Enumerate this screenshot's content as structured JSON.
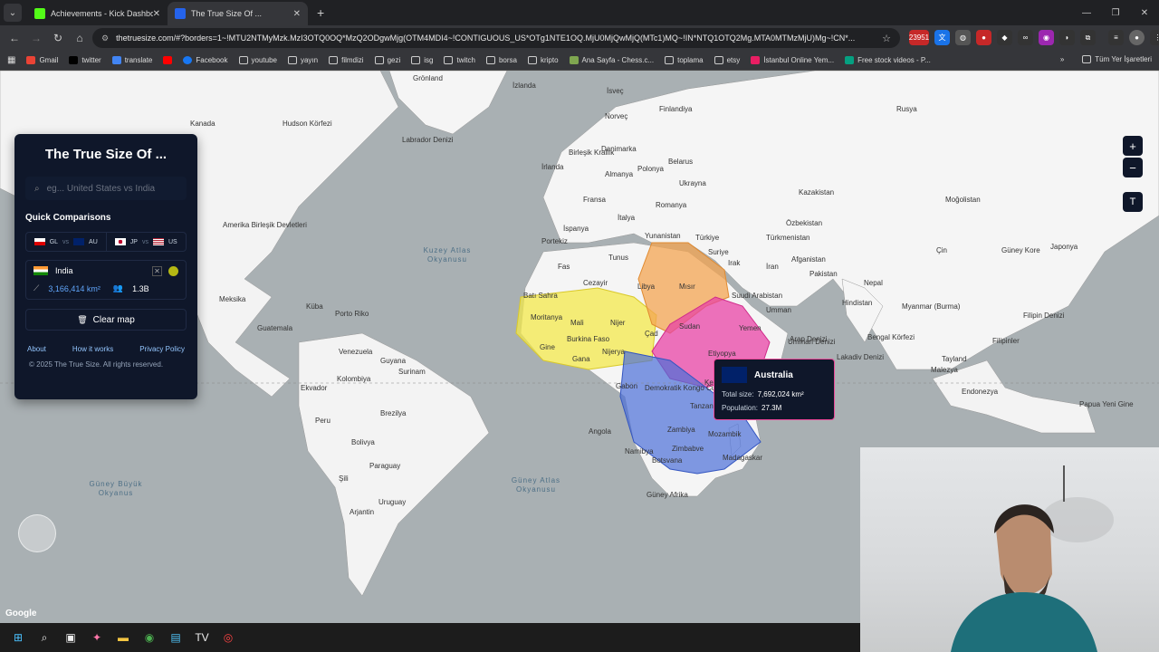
{
  "browser": {
    "tabs": [
      {
        "title": "Achievements - Kick Dashboard",
        "color": "#53fc18"
      },
      {
        "title": "The True Size Of ...",
        "color": "#2563eb"
      }
    ],
    "url": "thetruesize.com/#?borders=1~!MTU2NTMyMzk.MzI3OTQ0OQ*MzQ2ODgwMjg(OTM4MDI4~!CONTIGUOUS_US*OTg1NTE1OQ.MjU0MjQwMjQ(MTc1)MQ~!IN*NTQ1OTQ2Mg.MTA0MTMzMjU)Mg~!CN*...",
    "ext_badge": "23951",
    "bookmarks": [
      "Gmail",
      "twitter",
      "translate",
      "Facebook",
      "youtube",
      "yayın",
      "filmdizi",
      "gezi",
      "isg",
      "twitch",
      "borsa",
      "kripto",
      "Ana Sayfa - Chess.c...",
      "toplama",
      "etsy",
      "İstanbul Online Yem...",
      "Free stock videos - P..."
    ],
    "bookmarks_right": "Tüm Yer İşaretleri"
  },
  "panel": {
    "title": "The True Size Of ...",
    "search_placeholder": "eg... United States vs India",
    "quick_title": "Quick Comparisons",
    "quick": [
      {
        "a": "GL",
        "vs": "vs",
        "b": "AU"
      },
      {
        "a": "JP",
        "vs": "vs",
        "b": "US"
      }
    ],
    "country": {
      "name": "India",
      "area": "3,166,414 km²",
      "population": "1.3B",
      "color": "#b5b814"
    },
    "clear_label": "Clear map",
    "links": [
      "About",
      "How it works",
      "Privacy Policy"
    ],
    "copyright": "© 2025 The True Size. All rights reserved."
  },
  "tooltip": {
    "name": "Australia",
    "size_label": "Total size:",
    "size_value": "7,692,024 km²",
    "pop_label": "Population:",
    "pop_value": "27.3M"
  },
  "map": {
    "google": "Google",
    "labels": [
      "Grönland",
      "İzlanda",
      "İsveç",
      "Norveç",
      "Finlandiya",
      "Rusya",
      "Kanada",
      "Hudson Körfezi",
      "Labrador Denizi",
      "Birleşik Krallık",
      "Danimarka",
      "Belarus",
      "Polonya",
      "İrlanda",
      "Almanya",
      "Fransa",
      "Ukrayna",
      "Kazakistan",
      "Moğolistan",
      "Amerika Birleşik Devletleri",
      "İtalya",
      "Romanya",
      "İspanya",
      "Yunanistan",
      "Türkiye",
      "Özbekistan",
      "Türkmenistan",
      "Çin",
      "Güney Kore",
      "Japonya",
      "Portekiz",
      "Tunus",
      "Suriye",
      "Irak",
      "İran",
      "Afganistan",
      "Pakistan",
      "Fas",
      "Cezayir",
      "Libya",
      "Mısır",
      "Suudi Arabistan",
      "Meksika",
      "Küba",
      "Nepal",
      "Hindistan",
      "Umman",
      "Myanmar (Burma)",
      "Batı Sahra",
      "Moritanya",
      "Mali",
      "Nijer",
      "Çad",
      "Sudan",
      "Yemen",
      "Guatemala",
      "Porto Riko",
      "Burkina Faso",
      "Nijerya",
      "Gine",
      "Gana",
      "Etiyopya",
      "Venezuela",
      "Guyana",
      "Surinam",
      "Kolombiya",
      "Ekvador",
      "Gabon",
      "Demokratik Kongo Cumhuriyeti",
      "Tanzanya",
      "Kenya",
      "Peru",
      "Brezilya",
      "Bolivya",
      "Zambiya",
      "Mozambik",
      "Angola",
      "Namibya",
      "Zimbabve",
      "Botsvana",
      "Madagaskar",
      "Paraguay",
      "Şili",
      "Uruguay",
      "Güney Afrika",
      "Arjantin",
      "Filipinler",
      "Malezya",
      "Endonezya",
      "Papua Yeni Gine",
      "Tayland",
      "Bengal Körfezi",
      "Arap Denizi",
      "Filipin Denizi",
      "Umman Denizi",
      "Lakadiv Denizi"
    ],
    "oceans": [
      "Kuzey Atlas Okyanusu",
      "Güney Atlas Okyanusu",
      "Güney Büyük Okyanus"
    ]
  }
}
